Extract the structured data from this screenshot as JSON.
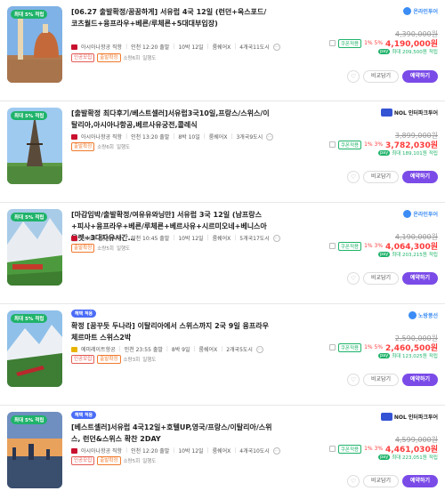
{
  "colors": {
    "accent": "#7b4be8",
    "sale_red": "#ff3b3b",
    "green": "#1fb36a",
    "pill_blue": "#4a6cf7"
  },
  "cards": [
    {
      "badge": "최대 5% 적립",
      "pill": "",
      "title": "[06.27 출발확정/꿈꿈하게] 서유럽 4국 12일 (런던+옥스포드/코츠월드+융프라우+베른/루체른+5대대부입장)",
      "airline": "아시아나항공 직항",
      "depart": "인천 12:20 출발",
      "duration": "10박 12일",
      "flag": "룸쉐어X",
      "cities": "4개국11도시",
      "tags": [
        "인공모집",
        "출발확정"
      ],
      "seats": "소량6회",
      "seats2": "일행도",
      "vendor": "온라인투어",
      "original_price": "4,390,000원",
      "coupon": "쿠폰적용",
      "discount": "1% 5%",
      "price": "4,190,000원",
      "pay": "pay",
      "points": "최대 209,500원",
      "points_label": "적립",
      "compare": "비교담기",
      "book": "예약하기"
    },
    {
      "badge": "최대 5% 적립",
      "pill": "",
      "title": "[출발확정 최다후기/베스트셀러]서유럽3국10일,프랑스/스위스/이탈리아,아시아나항공,베르사유궁전,콜레식",
      "airline": "아시아나항공 직항",
      "depart": "인천 13:20 출발",
      "duration": "8박 10일",
      "flag": "룸쉐어X",
      "cities": "3개국9도시",
      "tags": [
        "출발확정"
      ],
      "seats": "소량6회",
      "seats2": "일행도",
      "vendor": "NOL 인터파크투어",
      "original_price": "3,899,000원",
      "coupon": "쿠폰적용",
      "discount": "1% 3%",
      "price": "3,782,030원",
      "pay": "pay",
      "points": "최대 189,101원",
      "points_label": "적립",
      "compare": "비교담기",
      "book": "예약하기"
    },
    {
      "badge": "최대 5% 적립",
      "pill": "",
      "title": "[마감임박/출발확정/여유유와닝만] 서유럽 3국 12일 (남프랑스+피사+융프라우+베른/루체른+베르사유+시르미오네+베니스아울렛+3대자유시간…",
      "airline": "아시아나항공 직항",
      "depart": "인천 10:45 출발",
      "duration": "10박 12일",
      "flag": "룸쉐어X",
      "cities": "5개국17도시",
      "tags": [
        "출발확정"
      ],
      "seats": "소량5회",
      "seats2": "일행도",
      "vendor": "온라인투어",
      "original_price": "4,190,000원",
      "coupon": "쿠폰적용",
      "discount": "1% 3%",
      "price": "4,064,300원",
      "pay": "pay",
      "points": "최대 203,215원",
      "points_label": "적립",
      "compare": "비교담기",
      "book": "예약하기"
    },
    {
      "badge": "최대 5% 적립",
      "pill": "혜택 적용",
      "title": "확정 [꿈꾸듯 두나라] 이탈리아에서 스위스까지 2국 9일 융프라우 체르마트 스위스2박",
      "airline": "에미레이트항공",
      "depart": "인천 23:55 출발",
      "duration": "8박 9일",
      "flag": "룸쉐어X",
      "cities": "2개국5도시",
      "tags": [
        "인공모집",
        "출발확정"
      ],
      "seats": "소량3회",
      "seats2": "일행도",
      "vendor": "노랑풍선",
      "original_price": "2,590,000원",
      "coupon": "쿠폰적용",
      "discount": "1% 5%",
      "price": "2,460,500원",
      "pay": "pay",
      "points": "최대 123,025원",
      "points_label": "적립",
      "compare": "비교담기",
      "book": "예약하기"
    },
    {
      "badge": "최대 5% 적립",
      "pill": "혜택 적용",
      "title": "[베스트셀러]서유럽 4국12일+호텔UP,영국/프랑스/이탈리아/스위스, 런던&스위스 확찬 2DAY",
      "airline": "아시아나항공 직항",
      "depart": "인천 12:20 출발",
      "duration": "10박 12일",
      "flag": "룸쉐어X",
      "cities": "4개국10도시",
      "tags": [
        "인공모집",
        "출발확정"
      ],
      "seats": "소량5회",
      "seats2": "일행도",
      "vendor": "NOL 인터파크투어",
      "original_price": "4,599,000원",
      "coupon": "쿠폰적용",
      "discount": "1% 3%",
      "price": "4,461,030원",
      "pay": "pay",
      "points": "최대 223,051원",
      "points_label": "적립",
      "compare": "비교담기",
      "book": "예약하기"
    }
  ]
}
